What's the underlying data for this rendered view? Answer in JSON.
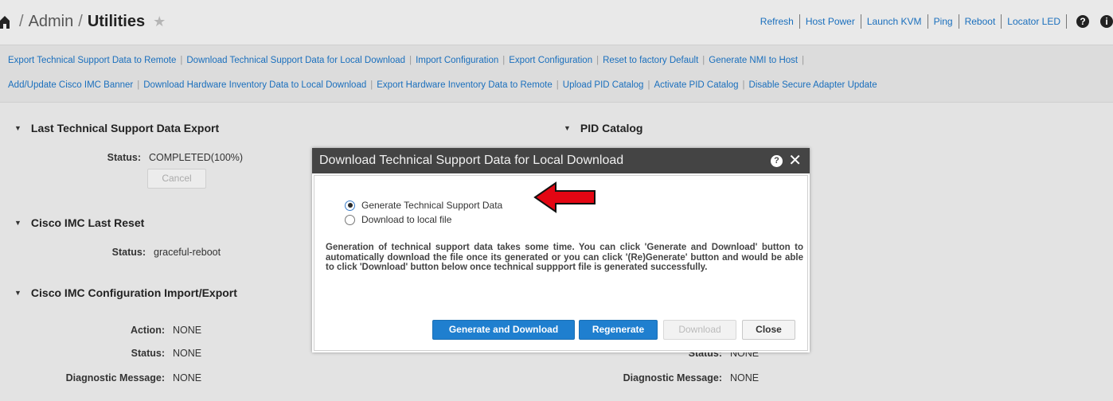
{
  "header": {
    "breadcrumb": [
      "Admin",
      "Utilities"
    ],
    "separator": "/",
    "quick_links": [
      "Refresh",
      "Host Power",
      "Launch KVM",
      "Ping",
      "Reboot",
      "Locator LED"
    ]
  },
  "actions": {
    "row1": [
      "Export Technical Support Data to Remote",
      "Download Technical Support Data for Local Download",
      "Import Configuration",
      "Export Configuration",
      "Reset to factory Default",
      "Generate NMI to Host"
    ],
    "row2": [
      "Add/Update Cisco IMC Banner",
      "Download Hardware Inventory Data to Local Download",
      "Export Hardware Inventory Data to Remote",
      "Upload PID Catalog",
      "Activate PID Catalog",
      "Disable Secure Adapter Update"
    ]
  },
  "sections": {
    "last_export": {
      "title": "Last Technical Support Data Export",
      "status_label": "Status:",
      "status_value": "COMPLETED(100%)",
      "cancel_label": "Cancel"
    },
    "last_reset": {
      "title": "Cisco IMC Last Reset",
      "status_label": "Status:",
      "status_value": "graceful-reboot"
    },
    "config_import_export": {
      "title": "Cisco IMC Configuration Import/Export",
      "action_label": "Action:",
      "action_value": "NONE",
      "status_label": "Status:",
      "status_value": "NONE",
      "diag_label": "Diagnostic Message:",
      "diag_value": "NONE"
    },
    "pid_catalog": {
      "title": "PID Catalog",
      "status_label": "Status:",
      "status_value": "NONE",
      "diag_label": "Diagnostic Message:",
      "diag_value": "NONE"
    }
  },
  "modal": {
    "title": "Download Technical Support Data for Local Download",
    "help": "?",
    "close": "✕",
    "options": [
      "Generate Technical Support Data",
      "Download to local file"
    ],
    "selected_option": "Generate Technical Support Data",
    "description": "Generation of technical support data takes some time. You can click 'Generate and Download' button to automatically download the file once its generated or you can click '(Re)Generate' button and would be able to click 'Download' button below once technical suppport file is generated successfully.",
    "buttons": {
      "generate_download": "Generate and Download",
      "regenerate": "Regenerate",
      "download": "Download",
      "close": "Close"
    }
  },
  "colors": {
    "link": "#1a6fbd",
    "primary_button": "#1f7fcf",
    "modal_header": "#444444",
    "arrow": "#e30613"
  },
  "icons": [
    "home-icon",
    "star-icon",
    "help-icon",
    "info-icon",
    "close-icon",
    "red-arrow-icon"
  ]
}
